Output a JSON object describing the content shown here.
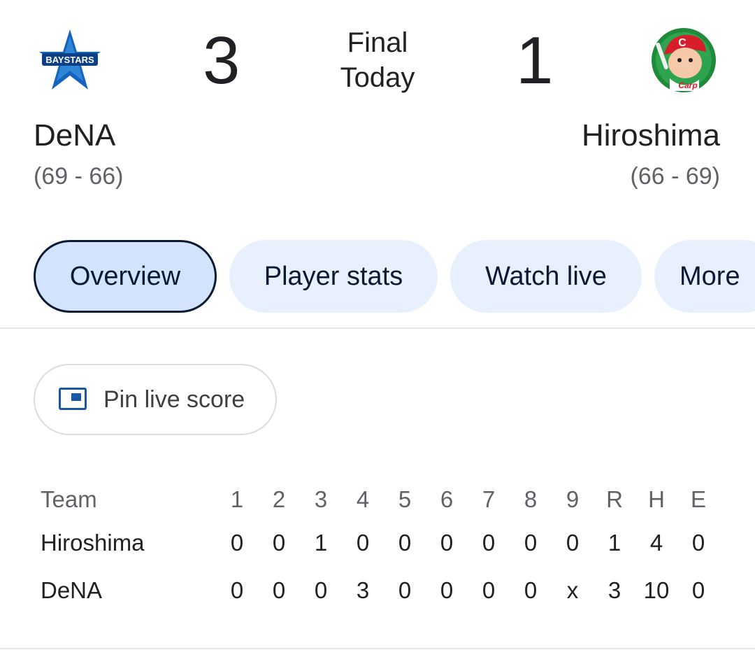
{
  "game": {
    "status_line1": "Final",
    "status_line2": "Today",
    "home": {
      "name": "DeNA",
      "record": "(69 - 66)",
      "score": "3",
      "logo_icon": "baystars-logo-icon",
      "logo_text": "BAYSTARS"
    },
    "away": {
      "name": "Hiroshima",
      "record": "(66 - 69)",
      "score": "1",
      "logo_icon": "carp-logo-icon",
      "logo_text": "Carp"
    }
  },
  "tabs": [
    {
      "label": "Overview",
      "active": true
    },
    {
      "label": "Player stats",
      "active": false
    },
    {
      "label": "Watch live",
      "active": false
    },
    {
      "label": "More",
      "active": false
    }
  ],
  "pin": {
    "label": "Pin live score",
    "icon": "pip-icon"
  },
  "linescore": {
    "header": {
      "team": "Team",
      "cols": [
        "1",
        "2",
        "3",
        "4",
        "5",
        "6",
        "7",
        "8",
        "9",
        "R",
        "H",
        "E"
      ]
    },
    "rows": [
      {
        "team": "Hiroshima",
        "cols": [
          "0",
          "0",
          "1",
          "0",
          "0",
          "0",
          "0",
          "0",
          "0",
          "1",
          "4",
          "0"
        ]
      },
      {
        "team": "DeNA",
        "cols": [
          "0",
          "0",
          "0",
          "3",
          "0",
          "0",
          "0",
          "0",
          "x",
          "3",
          "10",
          "0"
        ]
      }
    ]
  },
  "colors": {
    "text": "#202124",
    "muted": "#5f6368",
    "chip_bg": "#e8f0fe",
    "chip_active_bg": "#d3e3fd",
    "chip_text": "#0b1a33",
    "accent_blue": "#1a56a6",
    "carp_red": "#d81e2a",
    "carp_green": "#1f8a3a"
  }
}
